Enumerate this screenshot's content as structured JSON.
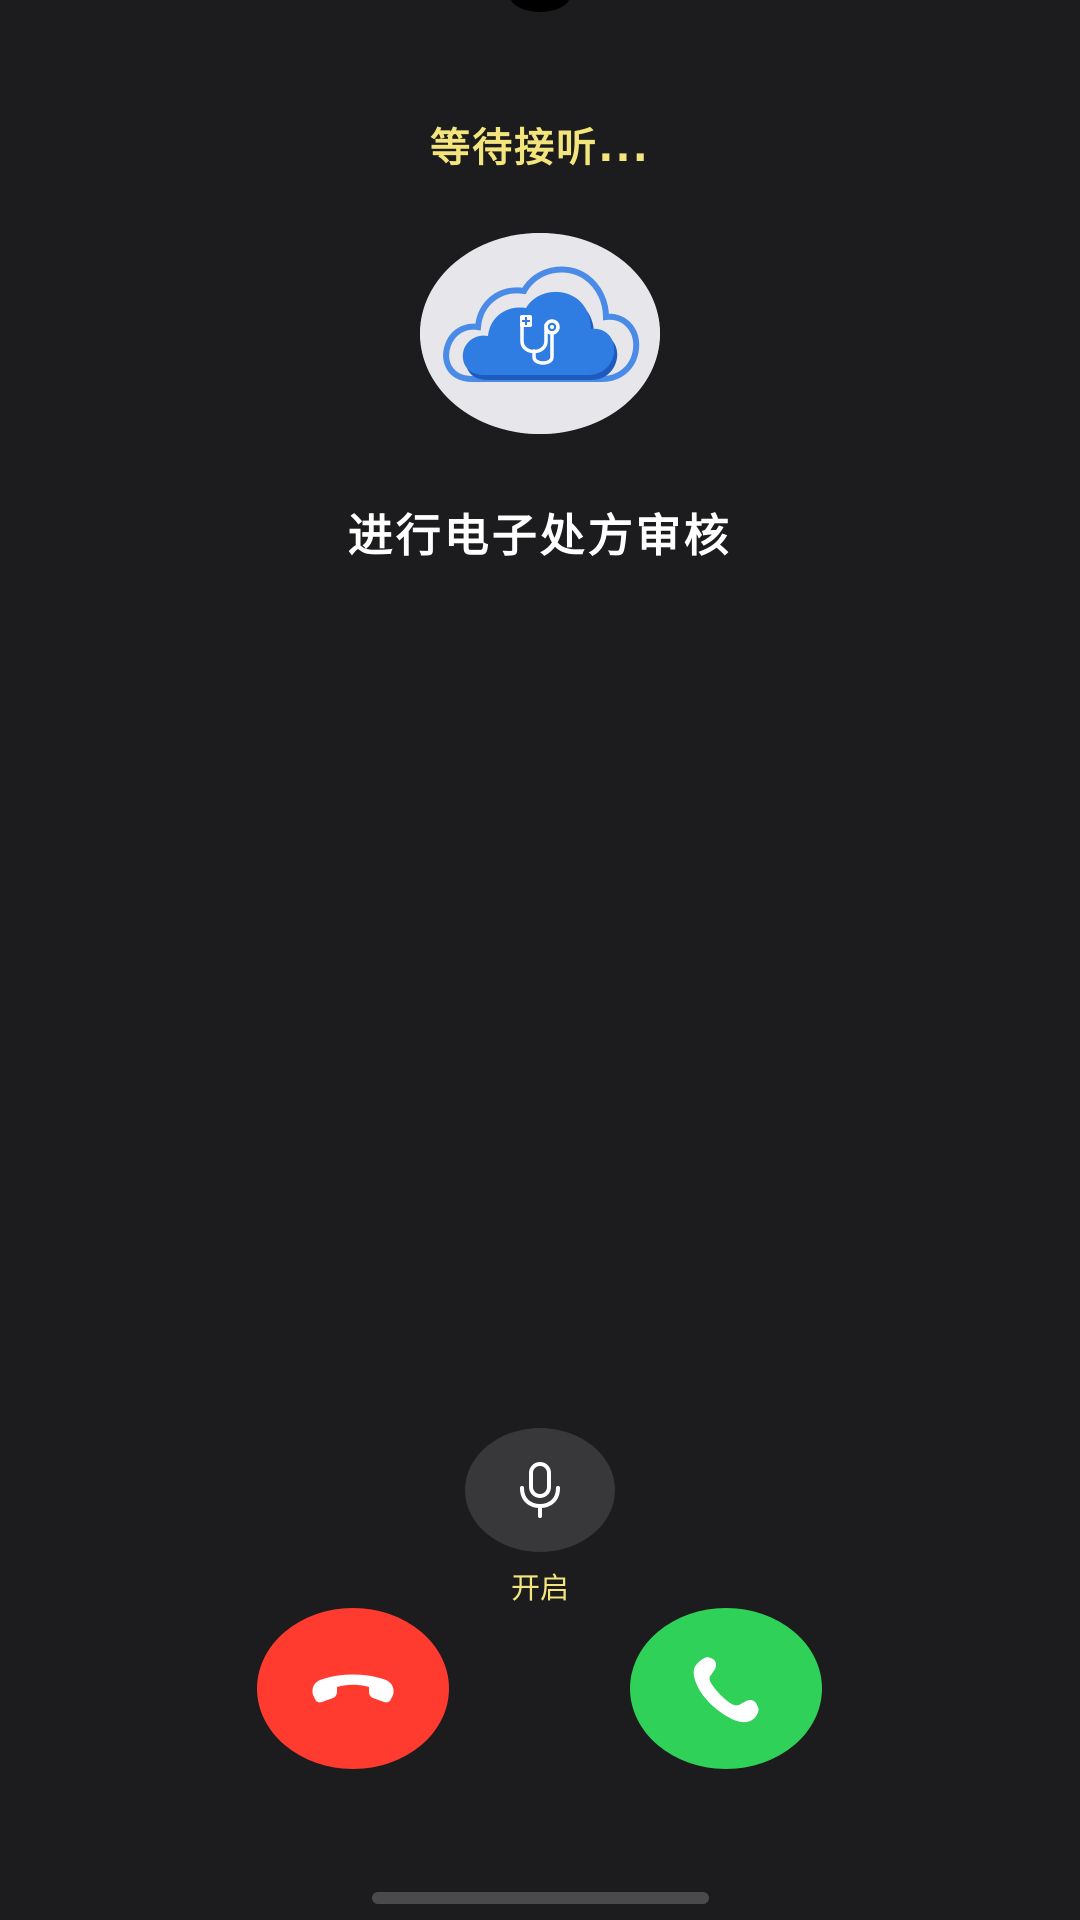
{
  "call": {
    "status_text": "等待接听...",
    "caller_name": "进行电子处方审核"
  },
  "controls": {
    "mic_label": "开启"
  },
  "colors": {
    "background": "#1c1c1e",
    "status_text": "#f3e57c",
    "mic_label": "#f3e57c",
    "decline": "#ff3b30",
    "answer": "#30d158",
    "mic_button": "#38383a"
  },
  "icons": {
    "avatar": "cloud-stethoscope-icon",
    "mic": "microphone-icon",
    "decline": "phone-hangup-icon",
    "answer": "phone-icon"
  }
}
